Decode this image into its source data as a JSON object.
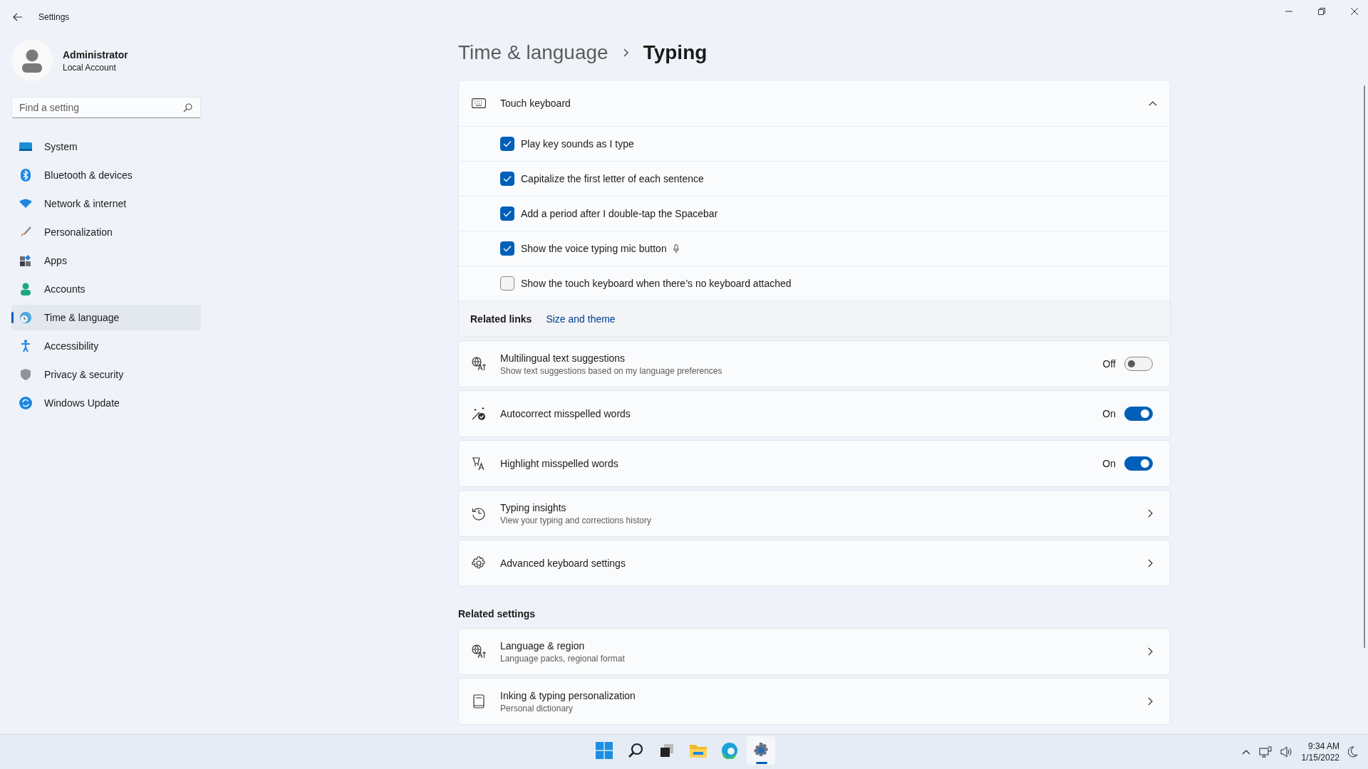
{
  "window": {
    "title": "Settings"
  },
  "account": {
    "name": "Administrator",
    "type": "Local Account"
  },
  "search": {
    "placeholder": "Find a setting"
  },
  "nav": [
    {
      "kind": "system",
      "label": "System",
      "selected": false
    },
    {
      "kind": "bluetooth",
      "label": "Bluetooth & devices",
      "selected": false
    },
    {
      "kind": "network",
      "label": "Network & internet",
      "selected": false
    },
    {
      "kind": "personalization",
      "label": "Personalization",
      "selected": false
    },
    {
      "kind": "apps",
      "label": "Apps",
      "selected": false
    },
    {
      "kind": "accounts",
      "label": "Accounts",
      "selected": false
    },
    {
      "kind": "time",
      "label": "Time & language",
      "selected": true
    },
    {
      "kind": "accessibility",
      "label": "Accessibility",
      "selected": false
    },
    {
      "kind": "privacy",
      "label": "Privacy & security",
      "selected": false
    },
    {
      "kind": "update",
      "label": "Windows Update",
      "selected": false
    }
  ],
  "breadcrumb": [
    "Time & language",
    "Typing"
  ],
  "touch_keyboard": {
    "title": "Touch keyboard",
    "expanded": true,
    "options": [
      {
        "label": "Play key sounds as I type",
        "checked": true,
        "mic": false
      },
      {
        "label": "Capitalize the first letter of each sentence",
        "checked": true,
        "mic": false
      },
      {
        "label": "Add a period after I double-tap the Spacebar",
        "checked": true,
        "mic": false
      },
      {
        "label": "Show the voice typing mic button",
        "checked": true,
        "mic": true
      },
      {
        "label": "Show the touch keyboard when there’s no keyboard attached",
        "checked": false,
        "mic": false
      }
    ],
    "related_label": "Related links",
    "related_link": "Size and theme"
  },
  "settings": [
    {
      "kind": "toggle",
      "title": "Multilingual text suggestions",
      "subtitle": "Show text suggestions based on my language preferences",
      "on": false,
      "state_label": "Off"
    },
    {
      "kind": "toggle",
      "title": "Autocorrect misspelled words",
      "on": true,
      "state_label": "On"
    },
    {
      "kind": "toggle",
      "title": "Highlight misspelled words",
      "on": true,
      "state_label": "On"
    },
    {
      "kind": "link",
      "title": "Typing insights",
      "subtitle": "View your typing and corrections history"
    },
    {
      "kind": "link",
      "title": "Advanced keyboard settings"
    }
  ],
  "related_settings": {
    "heading": "Related settings",
    "items": [
      {
        "title": "Language & region",
        "subtitle": "Language packs, regional format"
      },
      {
        "title": "Inking & typing personalization",
        "subtitle": "Personal dictionary"
      }
    ]
  },
  "taskbar": {
    "apps": [
      {
        "kind": "start",
        "selected": false
      },
      {
        "kind": "search",
        "selected": false
      },
      {
        "kind": "taskview",
        "selected": false
      },
      {
        "kind": "explorer",
        "selected": false
      },
      {
        "kind": "browser",
        "selected": false
      },
      {
        "kind": "settings",
        "selected": true
      }
    ],
    "time": "9:34 AM",
    "date": "1/15/2022"
  }
}
